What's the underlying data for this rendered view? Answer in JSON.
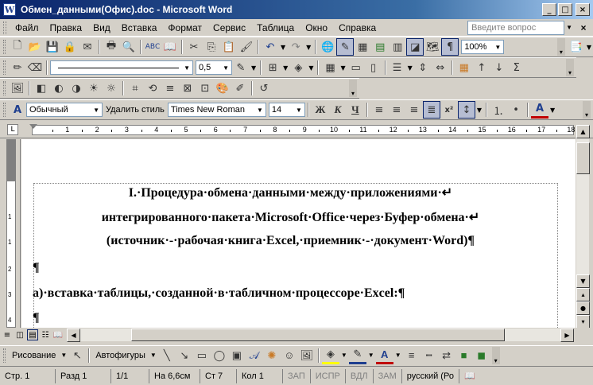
{
  "window": {
    "title": "Обмен_данными(Офис).doc - Microsoft Word",
    "app_icon_letter": "W",
    "buttons": {
      "minimize": "_",
      "maximize": "□",
      "close": "×"
    }
  },
  "menu": {
    "items": [
      "Файл",
      "Правка",
      "Вид",
      "Вставка",
      "Формат",
      "Сервис",
      "Таблица",
      "Окно",
      "Справка"
    ],
    "help_placeholder": "Введите вопрос",
    "close": "×"
  },
  "standard_toolbar": {
    "zoom": "100%",
    "icons": [
      "new-icon",
      "open-icon",
      "save-icon",
      "permission-icon",
      "email-icon",
      "print-icon",
      "print-preview-icon",
      "spelling-icon",
      "research-icon",
      "cut-icon",
      "copy-icon",
      "paste-icon",
      "format-painter-icon",
      "undo-icon",
      "redo-icon",
      "hyperlink-icon",
      "tables-borders-icon",
      "insert-table-icon",
      "insert-excel-icon",
      "columns-icon",
      "drawing-icon",
      "document-map-icon",
      "show-hide-icon"
    ],
    "show_hide_glyph": "¶"
  },
  "tables_toolbar": {
    "line_weight": "0,5",
    "sum_glyph": "Σ"
  },
  "formatting_toolbar": {
    "style": "Обычный",
    "delete_style": "Удалить стиль",
    "font": "Times New Roman",
    "size": "14",
    "bold": "Ж",
    "italic": "К",
    "underline": "Ч",
    "superscript": "x²",
    "font_color_letter": "A"
  },
  "ruler": {
    "tab_glyph": "L",
    "numbers": [
      "1",
      "2",
      "3",
      "4",
      "5",
      "6",
      "7",
      "8",
      "9",
      "10",
      "11",
      "12",
      "13",
      "14",
      "15",
      "16",
      "17",
      "18"
    ],
    "vertical_numbers": [
      "1",
      "1",
      "2",
      "3",
      "4"
    ]
  },
  "document": {
    "paragraphs": [
      "I.·Процедура·обмена·данными·между·приложениями·↵",
      "интегрированного·пакета·Microsoft·Office·через·Буфер·обмена·↵",
      "(источник·-·рабочая·книга·Excel,·приемник·-·документ·Word)¶",
      "¶",
      "а)·вставка·таблицы,·созданной·в·табличном·процессоре·Excel:¶",
      "¶"
    ]
  },
  "drawing_toolbar": {
    "drawing": "Рисование",
    "autoshapes": "Автофигуры",
    "font_color_letter": "A"
  },
  "status": {
    "page": "Стр. 1",
    "section": "Разд 1",
    "pages": "1/1",
    "at": "На 6,6см",
    "line": "Ст 7",
    "col": "Кол 1",
    "rec": "ЗАП",
    "trk": "ИСПР",
    "ext": "ВДЛ",
    "ovr": "ЗАМ",
    "language": "русский (Ро"
  },
  "colors": {
    "title_gradient_start": "#0a246a",
    "title_gradient_end": "#a6caf0",
    "chrome": "#d4d0c8",
    "font_color_red": "#c00000",
    "highlight_yellow": "#ffff00"
  }
}
